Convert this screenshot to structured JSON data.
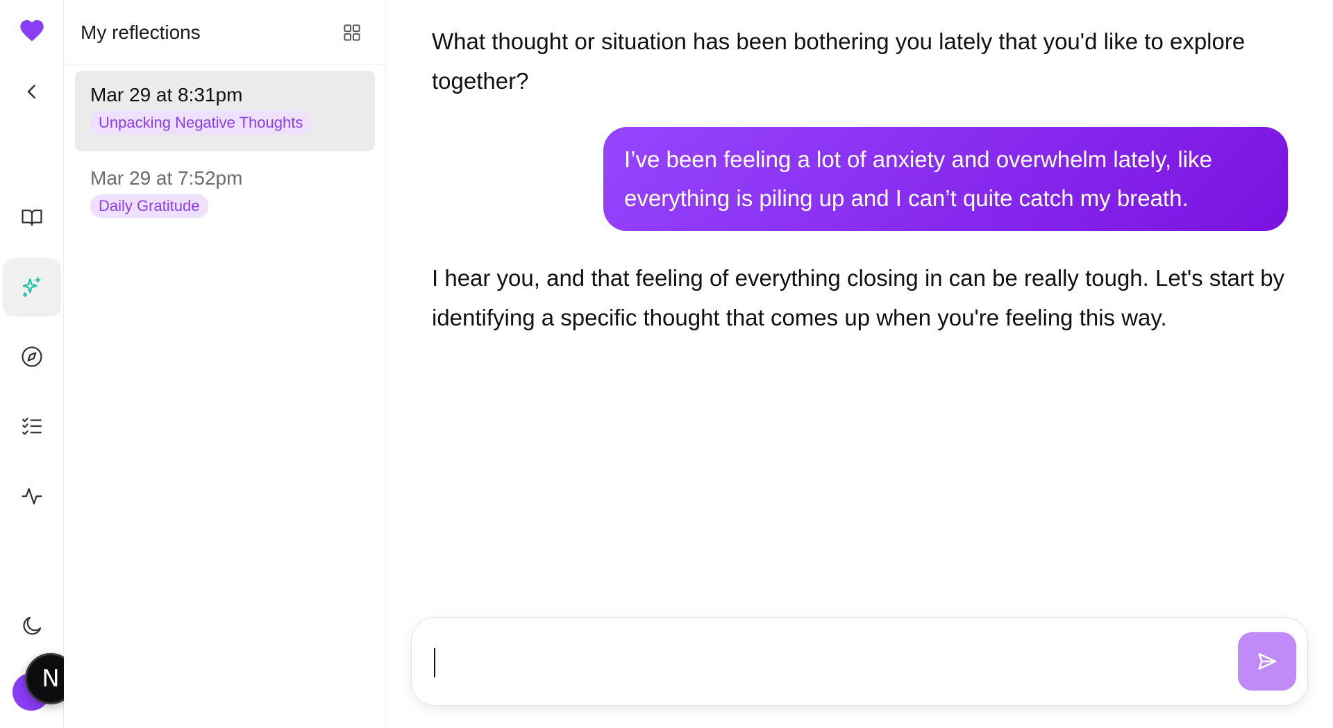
{
  "app": {
    "accent_color": "#8b3cf5",
    "logo_icon": "heart-icon"
  },
  "rail": {
    "items": [
      {
        "name": "collapse",
        "icon": "chevron-left-icon"
      },
      {
        "name": "journal",
        "icon": "book-open-icon"
      },
      {
        "name": "reflections",
        "icon": "sparkles-icon",
        "active": true
      },
      {
        "name": "explore",
        "icon": "compass-icon"
      },
      {
        "name": "tasks",
        "icon": "list-checks-icon"
      },
      {
        "name": "activity",
        "icon": "activity-icon"
      },
      {
        "name": "theme",
        "icon": "moon-icon"
      }
    ],
    "user_avatar_letter": "N"
  },
  "panel": {
    "title": "My reflections",
    "reflections": [
      {
        "date": "Mar 29 at 8:31pm",
        "tag": "Unpacking Negative Thoughts",
        "selected": true
      },
      {
        "date": "Mar 29 at 7:52pm",
        "tag": "Daily Gratitude",
        "selected": false
      }
    ]
  },
  "chat": {
    "messages": [
      {
        "role": "assistant",
        "text": "What thought or situation has been bothering you lately that you'd like to explore together?"
      },
      {
        "role": "user",
        "text": "I’ve been feeling a lot of anxiety and overwhelm lately, like everything is piling up and I can’t quite catch my breath."
      },
      {
        "role": "assistant",
        "text": "I hear you, and that feeling of everything closing in can be really tough. Let's start by identifying a specific thought that comes up when you're feeling this way."
      }
    ],
    "composer": {
      "value": "",
      "placeholder": ""
    }
  }
}
